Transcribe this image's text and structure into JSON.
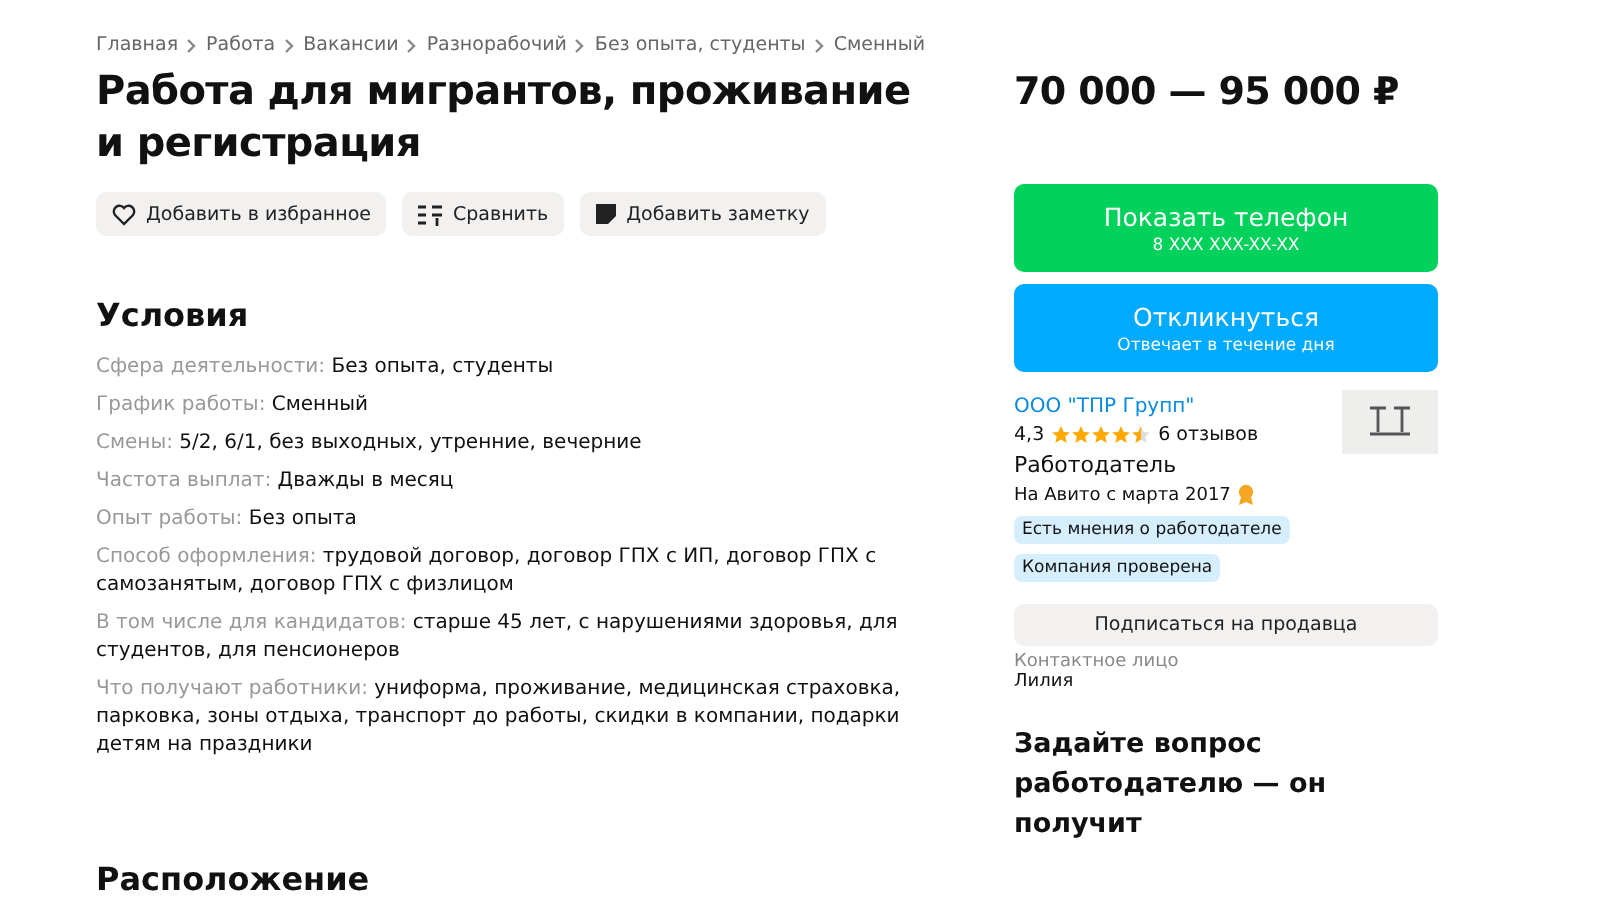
{
  "breadcrumbs": [
    "Главная",
    "Работа",
    "Вакансии",
    "Разнорабочий",
    "Без опыта, студенты",
    "Сменный"
  ],
  "title": "Работа для мигрантов, проживание и регистрация",
  "actions": [
    {
      "kind": "favorite",
      "label": "Добавить в избранное"
    },
    {
      "kind": "compare",
      "label": "Сравнить"
    },
    {
      "kind": "note",
      "label": "Добавить заметку"
    }
  ],
  "conditions": {
    "heading": "Условия",
    "items": [
      {
        "label": "Сфера деятельности:",
        "value": "Без опыта, студенты"
      },
      {
        "label": "График работы:",
        "value": "Сменный"
      },
      {
        "label": "Смены:",
        "value": "5/2, 6/1, без выходных, утренние, вечерние"
      },
      {
        "label": "Частота выплат:",
        "value": "Дважды в месяц"
      },
      {
        "label": "Опыт работы:",
        "value": "Без опыта"
      },
      {
        "label": "Способ оформления:",
        "value": "трудовой договор, договор ГПХ с ИП, договор ГПХ с самозанятым, договор ГПХ с физлицом"
      },
      {
        "label": "В том числе для кандидатов:",
        "value": "старше 45 лет, с нарушениями здоровья, для студентов, для пенсионеров"
      },
      {
        "label": "Что получают работники:",
        "value": "униформа, проживание, медицинская страховка, парковка, зоны отдыха, транспорт до работы, скидки в компании, подарки детям на праздники"
      }
    ]
  },
  "location_heading": "Расположение",
  "price": "70 000 — 95 000 ₽",
  "phone_button": {
    "label": "Показать телефон",
    "sub": "8 XXX XXX-XX-XX"
  },
  "respond_button": {
    "label": "Откликнуться",
    "sub": "Отвечает в течение дня"
  },
  "employer": {
    "name": "ООО \"ТПР Групп\"",
    "rating": "4,3",
    "stars": 4.5,
    "reviews": "6 отзывов",
    "role": "Работодатель",
    "since": "На Авито с марта 2017",
    "badges": [
      "Есть мнения о работодателе",
      "Компания проверена"
    ]
  },
  "subscribe_button": "Подписаться на продавца",
  "contact": {
    "label": "Контактное лицо",
    "name": "Лилия"
  },
  "question_heading": "Задайте вопрос работодателю — он получит"
}
